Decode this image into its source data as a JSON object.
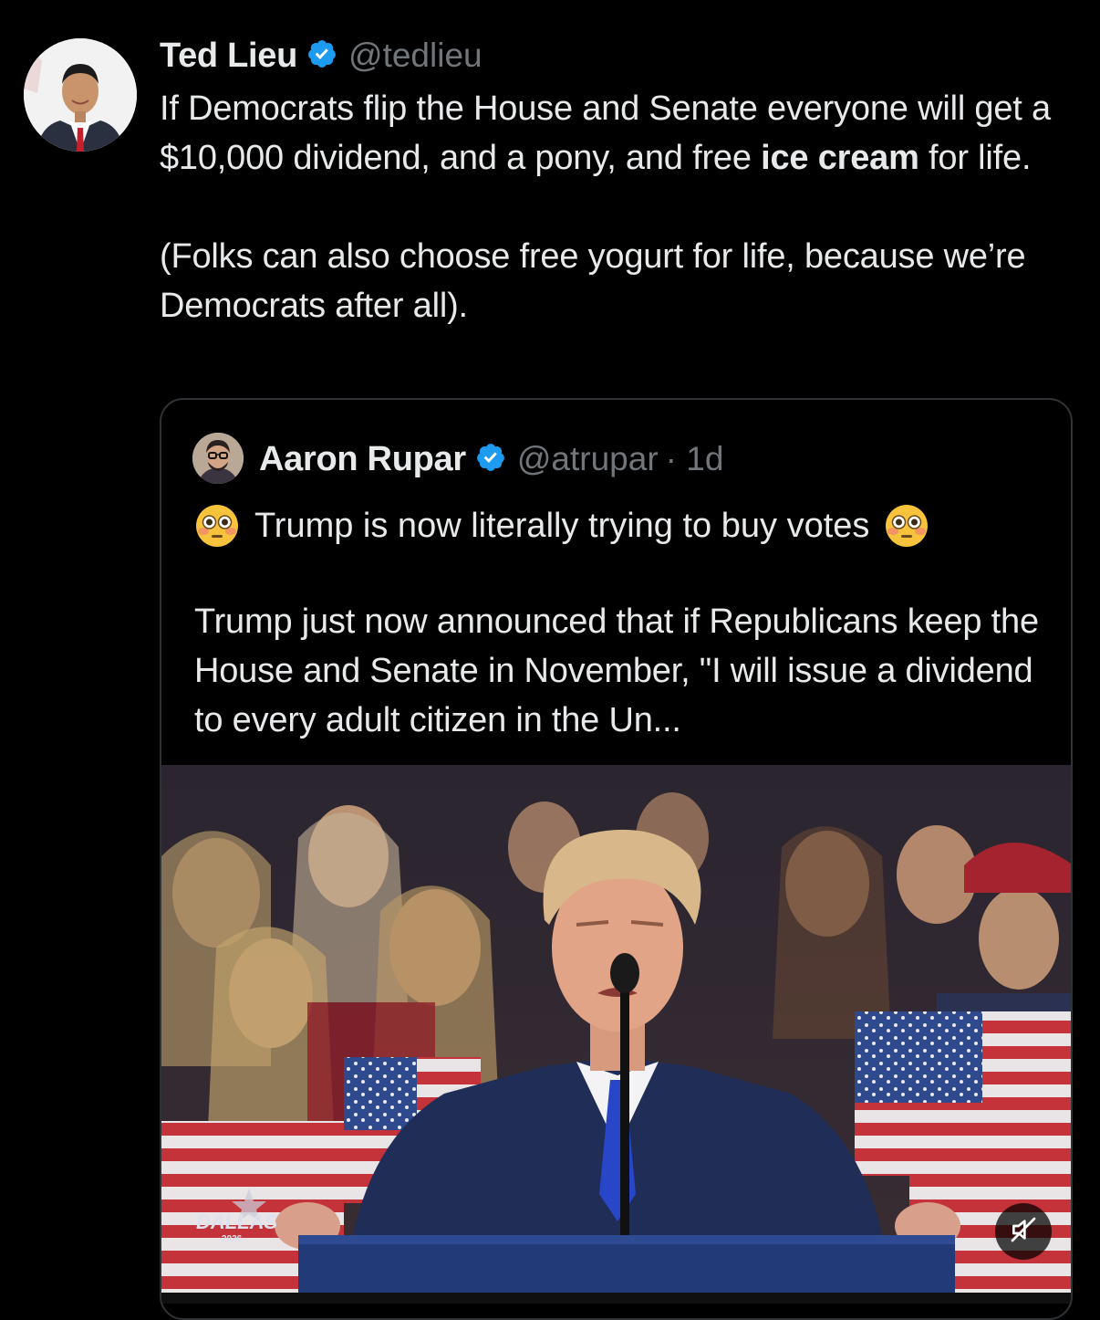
{
  "tweet": {
    "author_name": "Ted Lieu",
    "author_handle": "@tedlieu",
    "text_line1": "If Democrats flip the House and Senate everyone will get a $10,000 dividend, and a pony, and free ",
    "text_bold": "ice cream",
    "text_line1_end": " for life.",
    "text_paragraph2": "(Folks can also choose free yogurt for life, because we’re Democrats after all)."
  },
  "quoted_tweet": {
    "author_name": "Aaron Rupar",
    "author_handle": "@atrupar",
    "age": "· 1d",
    "line1": "Trump is now literally trying to buy votes",
    "body": "Trump just now announced that if Republicans keep the House and Senate in November, \"I will issue a dividend to every adult citizen in the Un...",
    "media": {
      "overlay_text": "DALLAS",
      "overlay_year": "2026"
    }
  },
  "icons": {
    "verified": "verified-badge-icon",
    "emoji": "flushed-face-emoji-icon",
    "mute": "muted-speaker-icon"
  },
  "colors": {
    "background": "#000000",
    "text": "#e7e9ea",
    "secondary_text": "#71767b",
    "verified_blue": "#1d9bf0",
    "border": "#2f3336"
  }
}
